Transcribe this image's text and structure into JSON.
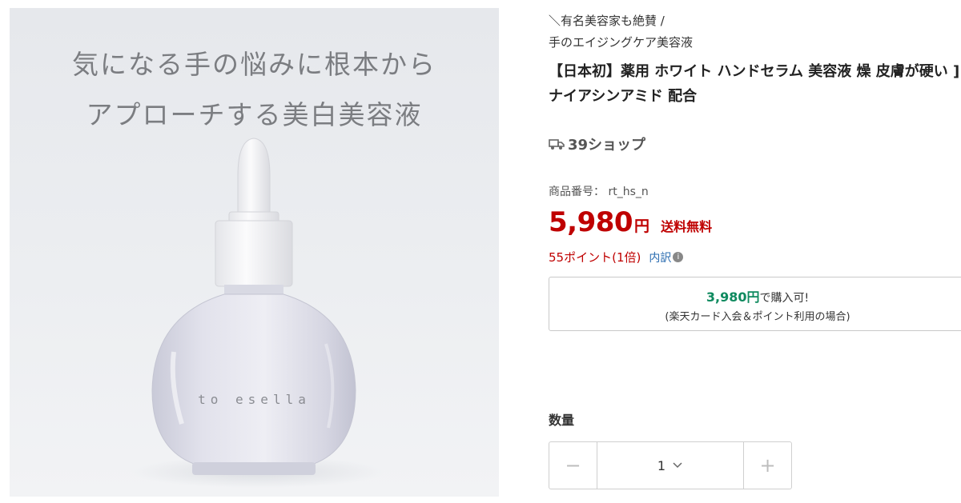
{
  "image": {
    "hero_line_1": "気になる手の悩みに根本から",
    "hero_line_2": "アプローチする美白美容液",
    "bottle_brand": "to esella"
  },
  "product": {
    "tagline": "＼有名美容家も絶賛 /",
    "subtitle": "手のエイジングケア美容液",
    "title": "【日本初】薬用 ホワイト ハンドセラム 美容液 燥 皮膚が硬い ] ナイアシンアミド 配合",
    "shop_name": "39ショップ",
    "shop_icon": "truck-icon",
    "item_number_label": "商品番号：",
    "item_number": "rt_hs_n",
    "price": "5,980",
    "currency": "円",
    "shipping": "送料無料",
    "points": "55ポイント(1倍)",
    "points_breakdown": "内訳",
    "info_icon": "i"
  },
  "promo": {
    "price": "3,980円",
    "price_suffix": "で購入可!",
    "note": "(楽天カード入会＆ポイント利用の場合)"
  },
  "quantity": {
    "label": "数量",
    "minus": "−",
    "value": "1",
    "plus": "+"
  },
  "colors": {
    "price_red": "#bf0000",
    "promo_green": "#0f8a5f",
    "link_blue": "#2a6cb0"
  }
}
